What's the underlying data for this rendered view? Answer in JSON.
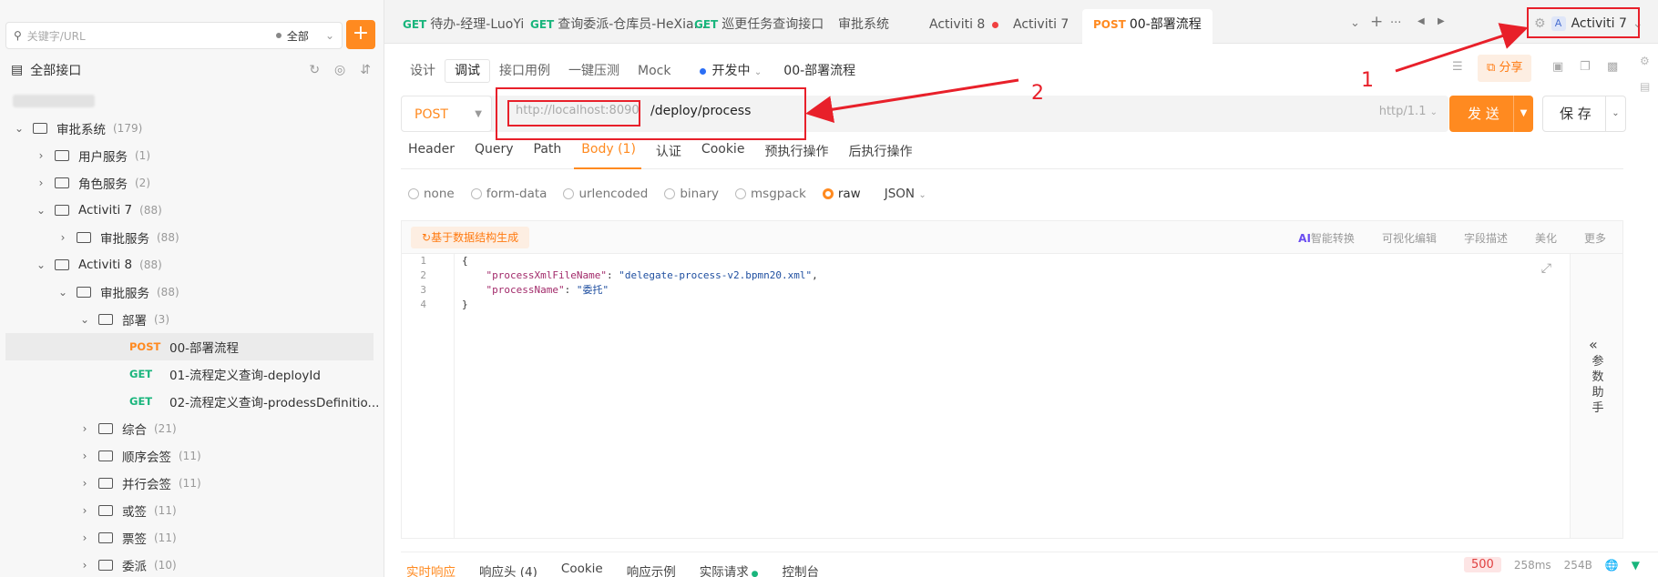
{
  "sidebar": {
    "search_placeholder": "关键字/URL",
    "filter": "全部",
    "add": "+",
    "title": "全部接口",
    "tree": [
      {
        "label": "审批系统",
        "count": "(179)",
        "level": 0,
        "open": true
      },
      {
        "label": "用户服务",
        "count": "(1)",
        "level": 1,
        "open": false
      },
      {
        "label": "角色服务",
        "count": "(2)",
        "level": 1,
        "open": false
      },
      {
        "label": "Activiti 7",
        "count": "(88)",
        "level": 1,
        "open": true
      },
      {
        "label": "审批服务",
        "count": "(88)",
        "level": 2,
        "open": false
      },
      {
        "label": "Activiti 8",
        "count": "(88)",
        "level": 1,
        "open": true
      },
      {
        "label": "审批服务",
        "count": "(88)",
        "level": 2,
        "open": true
      },
      {
        "label": "部署",
        "count": "(3)",
        "level": 3,
        "open": true
      },
      {
        "method": "POST",
        "label": "00-部署流程",
        "level": 4,
        "selected": true
      },
      {
        "method": "GET",
        "label": "01-流程定义查询-deployId",
        "level": 4
      },
      {
        "method": "GET",
        "label": "02-流程定义查询-prodessDefinitio...",
        "level": 4
      },
      {
        "label": "综合",
        "count": "(21)",
        "level": 3,
        "open": false
      },
      {
        "label": "顺序会签",
        "count": "(11)",
        "level": 3,
        "open": false
      },
      {
        "label": "并行会签",
        "count": "(11)",
        "level": 3,
        "open": false
      },
      {
        "label": "或签",
        "count": "(11)",
        "level": 3,
        "open": false
      },
      {
        "label": "票签",
        "count": "(11)",
        "level": 3,
        "open": false
      },
      {
        "label": "委派",
        "count": "(10)",
        "level": 3,
        "open": false
      }
    ]
  },
  "tabs": [
    {
      "method": "GET",
      "label": "待办-经理-LuoYi"
    },
    {
      "method": "GET",
      "label": "查询委派-仓库员-HeXia..."
    },
    {
      "method": "GET",
      "label": "巡更任务查询接口"
    },
    {
      "label": "审批系统"
    },
    {
      "label": "Activiti 8",
      "dot": true
    },
    {
      "label": "Activiti 7"
    },
    {
      "method": "POST",
      "label": "00-部署流程",
      "active": true
    }
  ],
  "env": {
    "badge": "A",
    "label": "Activiti 7"
  },
  "modes": [
    "设计",
    "调试",
    "接口用例",
    "一键压测",
    "Mock"
  ],
  "status": "开发中",
  "api_name": "00-部署流程",
  "share": "分享",
  "request": {
    "method": "POST",
    "base_url": "http://localhost:8090",
    "path": "/deploy/process",
    "protocol": "http/1.1",
    "send": "发 送",
    "save": "保 存"
  },
  "req_tabs": [
    "Header",
    "Query",
    "Path",
    "Body (1)",
    "认证",
    "Cookie",
    "预执行操作",
    "后执行操作"
  ],
  "body_types": [
    "none",
    "form-data",
    "urlencoded",
    "binary",
    "msgpack",
    "raw"
  ],
  "body_format": "JSON",
  "editor": {
    "generate": "基于数据结构生成",
    "ai": "AI",
    "actions": [
      "智能转换",
      "可视化编辑",
      "字段描述",
      "美化",
      "更多"
    ],
    "assistant": "参数助手",
    "lines": [
      "1",
      "2",
      "3",
      "4"
    ],
    "key1": "\"processXmlFileName\"",
    "val1": "\"delegate-process-v2.bpmn20.xml\"",
    "key2": "\"processName\"",
    "val2": "\"委托\""
  },
  "response": {
    "tabs": [
      "实时响应",
      "响应头 (4)",
      "Cookie",
      "响应示例",
      "实际请求",
      "控制台"
    ],
    "status": "500",
    "time": "258ms",
    "size": "254B"
  },
  "annotations": [
    "1",
    "2"
  ],
  "colors": {
    "accent": "#ff8a20",
    "get": "#19b57c",
    "annotation": "#e8202a"
  }
}
